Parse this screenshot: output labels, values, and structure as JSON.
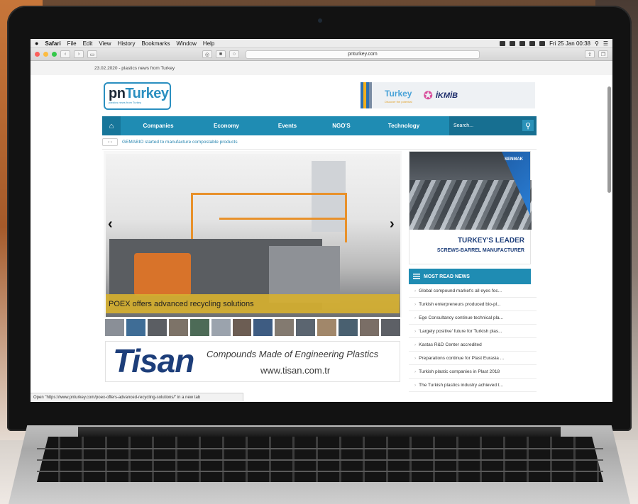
{
  "menubar": {
    "apple_icon": "apple-icon",
    "app": "Safari",
    "items": [
      "File",
      "Edit",
      "View",
      "History",
      "Bookmarks",
      "Window",
      "Help"
    ],
    "clock": "Fri 25 Jan 00:38"
  },
  "toolbar": {
    "url": "pnturkey.com"
  },
  "page": {
    "date_line": "23.02.2020 - plastics news from Turkey",
    "logo": {
      "pn": "pn",
      "turkey": "Turkey",
      "tagline": "plastics news from Turkey"
    },
    "top_banner": {
      "title": "Turkey",
      "subtitle": "Discover the potential",
      "brand": "İKMİB"
    },
    "nav": {
      "items": [
        "Companies",
        "Economy",
        "Events",
        "NGO'S",
        "Technology"
      ],
      "search_placeholder": "Search..."
    },
    "ticker": {
      "text": "GEMABIO started to manufacture compostable products"
    },
    "slider": {
      "caption": "POEX offers advanced recycling solutions"
    },
    "tisan_ad": {
      "logo": "Tisan",
      "tagline": "Compounds Made of Engineering Plastics",
      "url": "www.tisan.com.tr"
    },
    "senmak_ad": {
      "brand": "SENMAK",
      "headline": "TURKEY'S LEADER",
      "subline": "SCREWS-BARREL MANUFACTURER"
    },
    "most_read": {
      "title": "MOST READ NEWS",
      "items": [
        "Global compound market's all eyes foc...",
        "Turkish enterpreneurs produced bio-pl...",
        "Ege Consultancy continue technical pla...",
        "'Largely positive' future for Turkish plas...",
        "Kastas R&D Center accredited",
        "Preparations continue for Plast Eurasia ...",
        "Turkish plastic companies in Plast 2018",
        "The Turkish plastics industry achieved t..."
      ]
    },
    "status": "Open \"https://www.pnturkey.com/poex-offers-advanced-recycling-solutions/\" in a new tab"
  },
  "colors": {
    "nav": "#1f8cb3",
    "caption": "#d6b030",
    "tisan": "#1d3e7a"
  }
}
